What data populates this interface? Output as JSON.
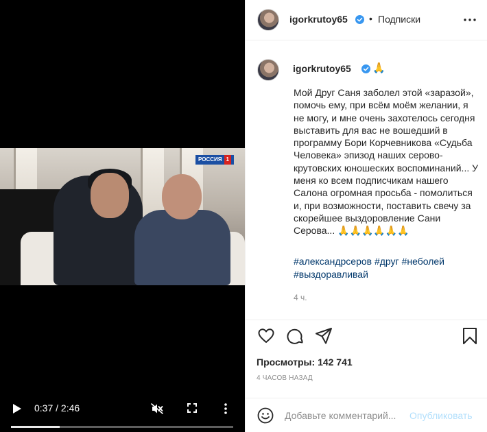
{
  "video": {
    "channel_logo_text": "РОССИЯ",
    "channel_logo_number": "1",
    "time_display": "0:37 / 2:46",
    "progress": 0.22,
    "icons": {
      "play": "play-icon",
      "mute": "muted-speaker-icon",
      "fullscreen": "fullscreen-icon",
      "more": "more-vertical-icon"
    }
  },
  "post_header": {
    "username": "igorkrutoy65",
    "separator": "•",
    "follow_state": "Подписки"
  },
  "caption": {
    "username": "igorkrutoy65",
    "inline_emoji": "🙏",
    "text": "Мой Друг Саня заболел этой «заразой», помочь ему, при всём моём желании, я не могу, и мне очень захотелось сегодня выставить для вас не вошедший в программу Бори Корчевникова «Судьба Человека» эпизод наших серово-крутовских юношеских воспоминаний... У меня ко всем подписчикам нашего Салона огромная просьба - помолиться и, при возможности, поставить свечу за скорейшее выздоровление Сани Серова... 🙏🙏🙏🙏🙏🙏",
    "hashtags": [
      "#александрсеров",
      "#друг",
      "#неболей",
      "#выздоравливай"
    ],
    "time_ago": "4 ч."
  },
  "actions": {
    "icons": [
      "heart-icon",
      "comment-icon",
      "share-icon",
      "bookmark-icon"
    ]
  },
  "stats": {
    "views_label": "Просмотры:",
    "views_value": "142 741",
    "date": "4 ЧАСОВ НАЗАД"
  },
  "comment": {
    "placeholder": "Добавьте комментарий...",
    "publish_label": "Опубликовать"
  },
  "colors": {
    "verified": "#3897f0",
    "link": "#00376b",
    "muted_text": "#8e8e8e",
    "publish_disabled": "#b2dffc"
  }
}
